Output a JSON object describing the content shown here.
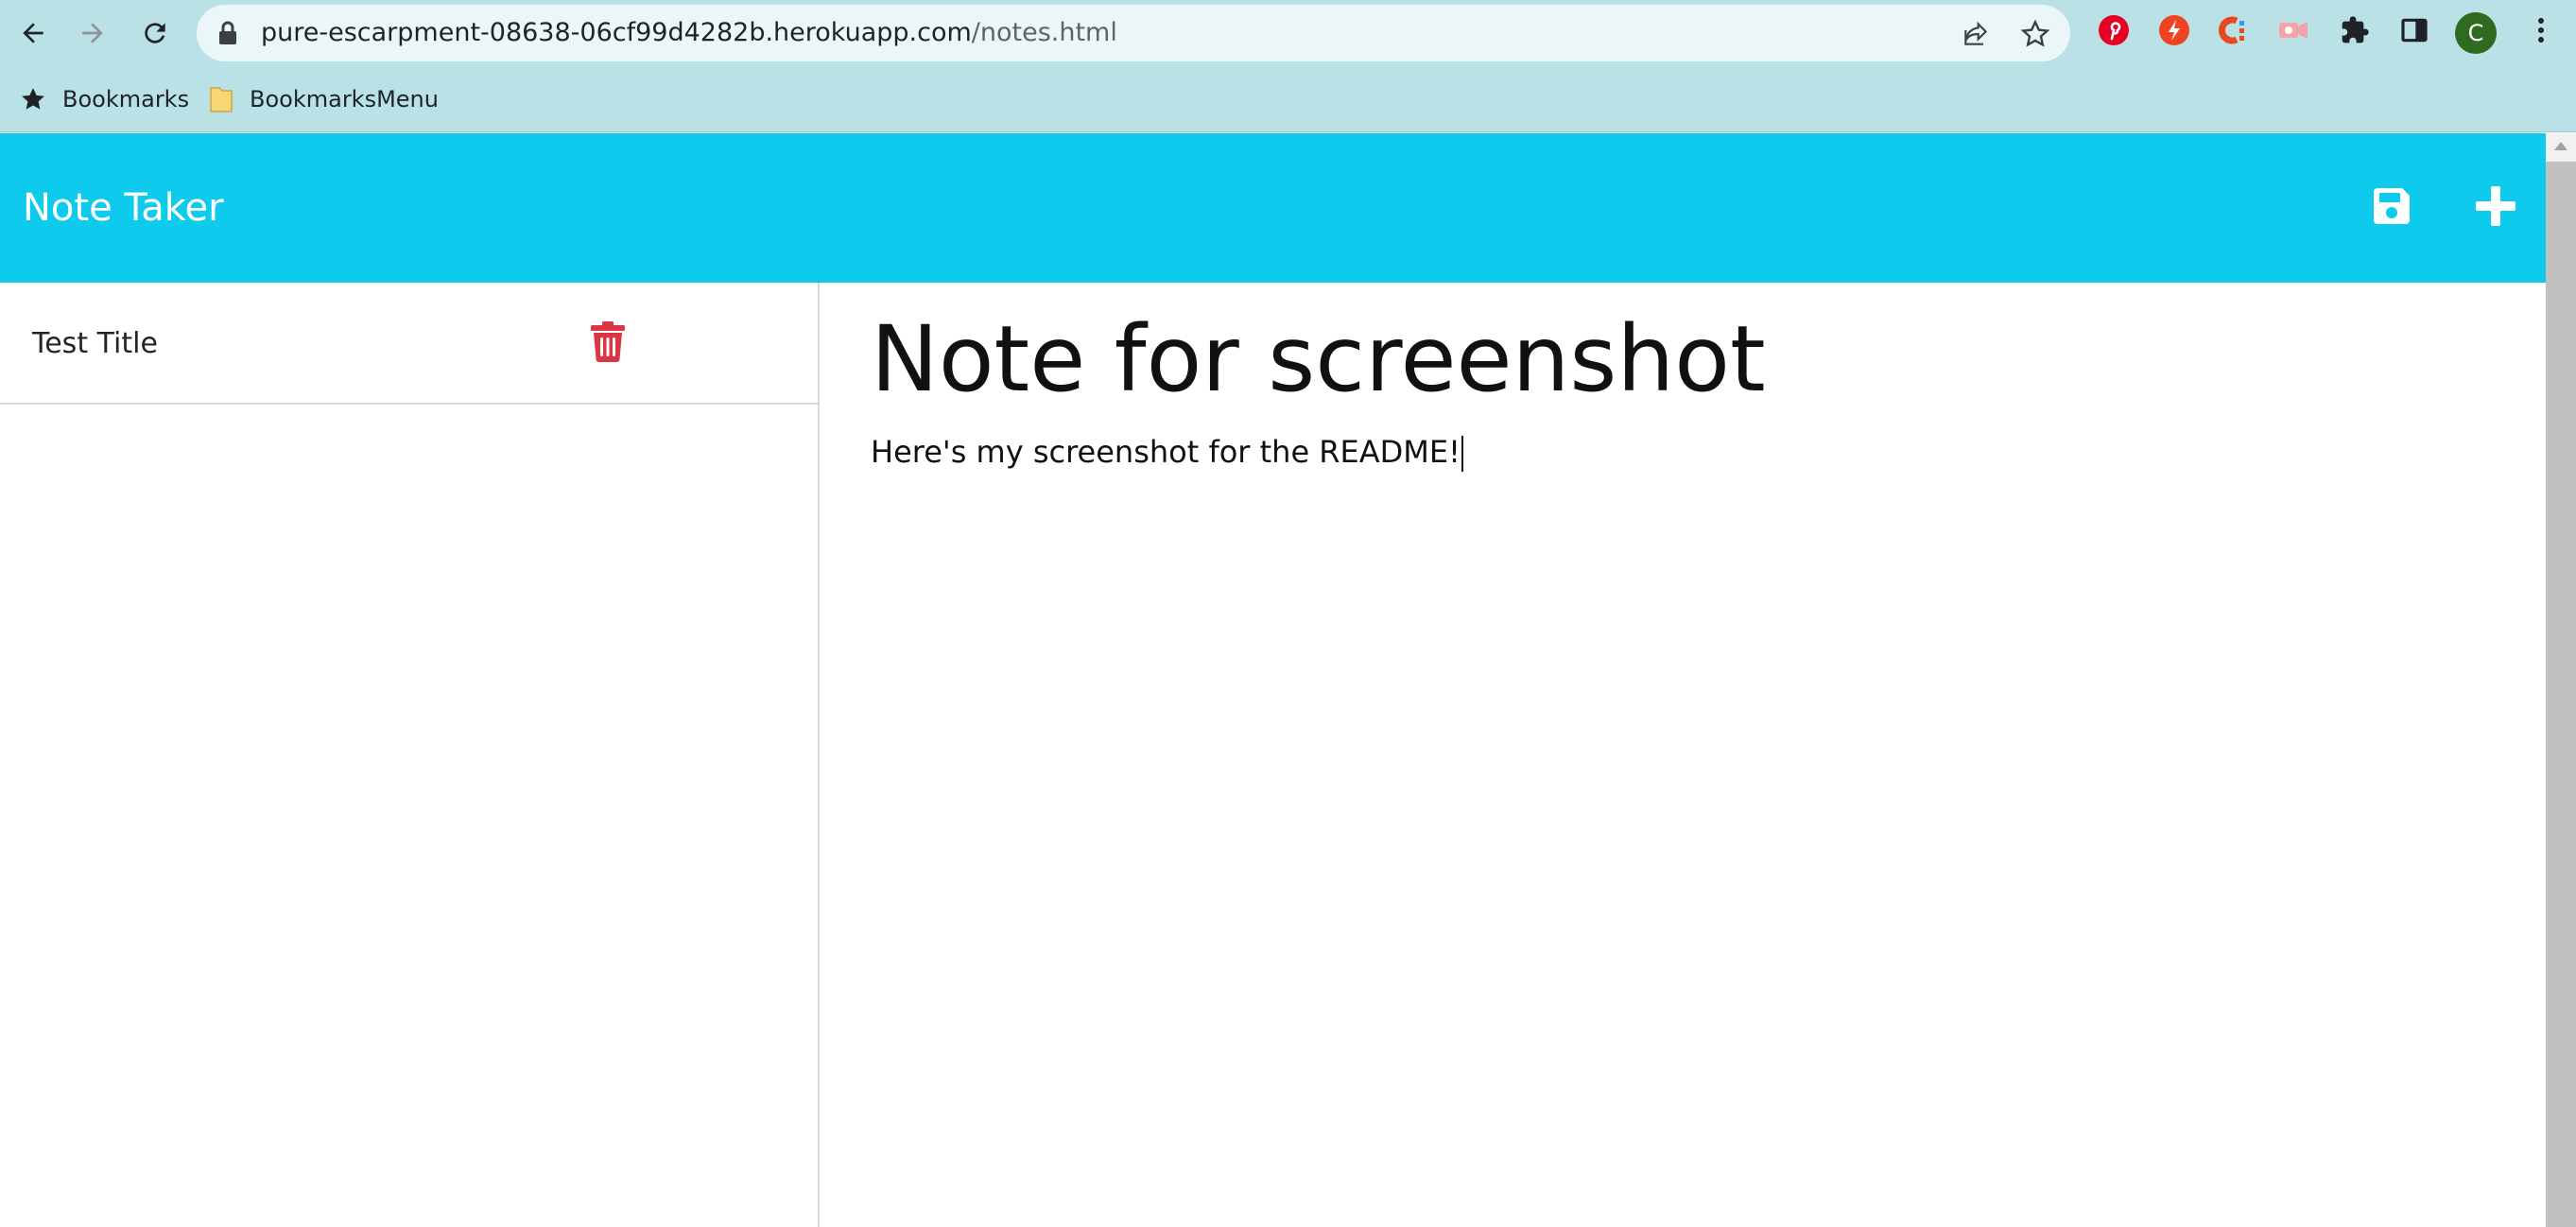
{
  "browser": {
    "url_host": "pure-escarpment-08638-06cf99d4282b.herokuapp.com",
    "url_path": "/notes.html",
    "profile_initial": "C",
    "icons": {
      "back": "arrow-left-icon",
      "forward": "arrow-right-icon",
      "reload": "reload-icon",
      "lock": "lock-icon",
      "share": "share-icon",
      "bookmark": "star-icon",
      "extensions": "puzzle-icon",
      "side_panel": "side-panel-icon",
      "menu": "kebab-menu-icon"
    },
    "extensions": [
      "pinterest-icon",
      "flash-extension-icon",
      "c-extension-icon",
      "video-extension-icon"
    ]
  },
  "bookmarks_bar": {
    "items": [
      {
        "label": "Bookmarks",
        "icon": "star-icon"
      },
      {
        "label": "BookmarksMenu",
        "icon": "folder-icon"
      }
    ]
  },
  "app": {
    "title": "Note Taker",
    "colors": {
      "header": "#0ecbee",
      "delete": "#dc3545"
    },
    "header_buttons": {
      "save": "save-icon",
      "new_note": "plus-icon"
    },
    "notes": [
      {
        "title": "Test Title"
      }
    ],
    "editor": {
      "title": "Note for screenshot",
      "body": "Here's my screenshot for the README!"
    }
  }
}
